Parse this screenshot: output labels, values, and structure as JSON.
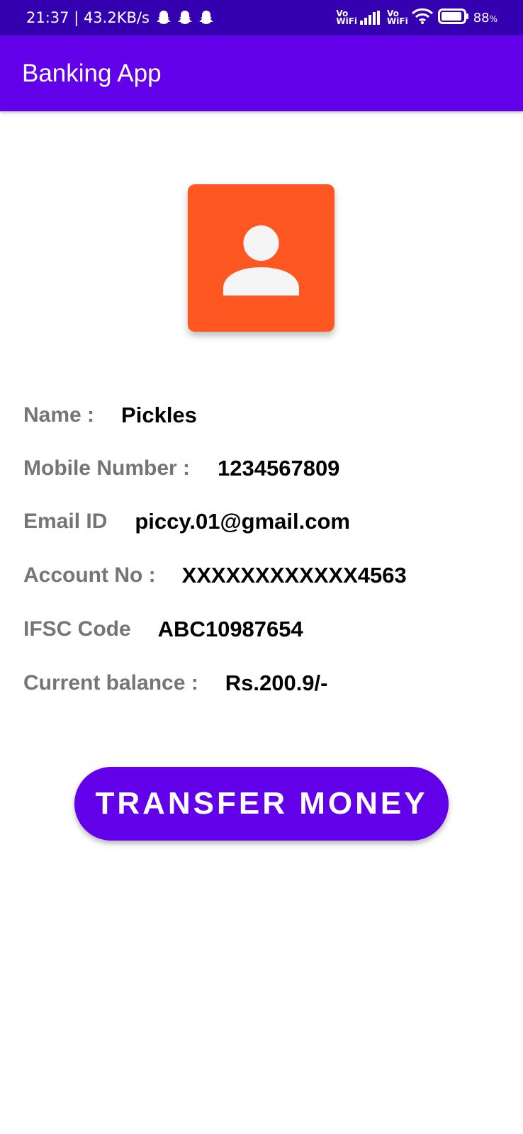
{
  "status_bar": {
    "time_speed": "21:37 | 43.2KB/s",
    "notification_icons": [
      "snapchat-ghost-icon",
      "snapchat-ghost-icon",
      "snapchat-ghost-icon"
    ],
    "vowifi_top": "Vo",
    "vowifi_bottom": "WiFi",
    "battery_value": "88",
    "battery_unit": "%"
  },
  "app_bar": {
    "title": "Banking App"
  },
  "profile": {
    "avatar_icon": "person-icon",
    "avatar_color": "#ff5722"
  },
  "details": {
    "name_label": "Name :",
    "name_value": "Pickles",
    "mobile_label": "Mobile Number :",
    "mobile_value": "1234567809",
    "email_label": "Email ID",
    "email_value": "piccy.01@gmail.com",
    "account_label": "Account No :",
    "account_value": "XXXXXXXXXXXX4563",
    "ifsc_label": "IFSC Code",
    "ifsc_value": "ABC10987654",
    "balance_label": "Current balance :",
    "balance_value": "Rs.200.9/-"
  },
  "actions": {
    "transfer_label": "TRANSFER MONEY"
  },
  "colors": {
    "primary": "#6200ea",
    "status_bar": "#3500b0",
    "label_gray": "#757575"
  }
}
